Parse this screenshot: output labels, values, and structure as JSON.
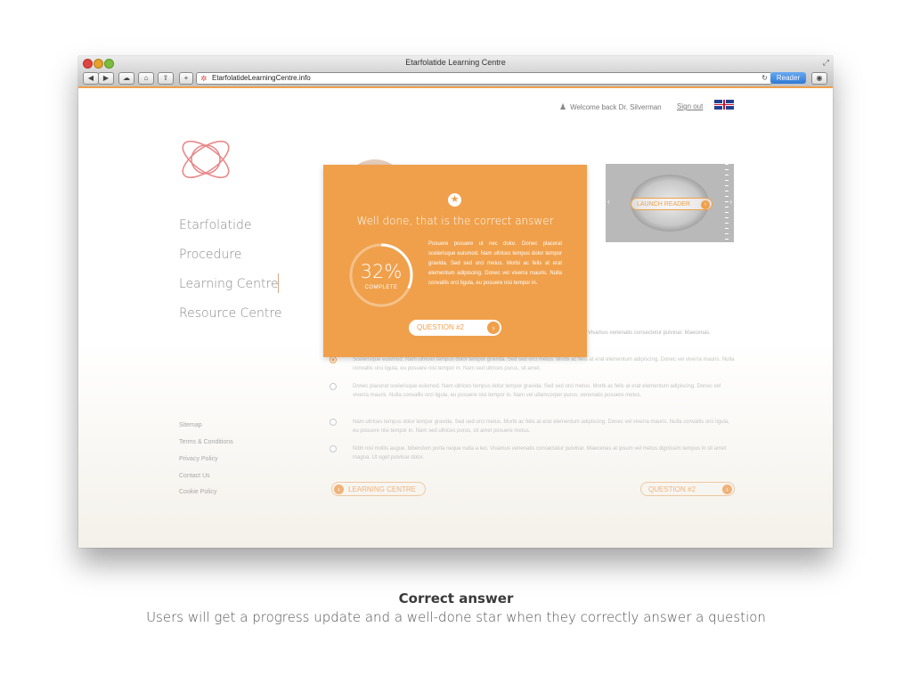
{
  "window": {
    "title": "Etarfolatide Learning Centre",
    "url": "EtarfolatideLearningCentre.info",
    "reader_label": "Reader",
    "reload_glyph": "↻",
    "fullscreen_glyph": "⤢",
    "toolbar": {
      "back": "◀",
      "forward": "▶",
      "cloud": "☁",
      "home": "⌂",
      "share": "⇪",
      "add": "+",
      "downloads": "◉"
    }
  },
  "header": {
    "welcome": "Welcome back Dr. Silverman",
    "sign_out": "Sign out",
    "language_flag": "uk-flag-icon"
  },
  "sidebar": {
    "items": [
      {
        "label": "Etarfolatide"
      },
      {
        "label": "Procedure"
      },
      {
        "label": "Learning Centre",
        "active": true
      },
      {
        "label": "Resource Centre"
      }
    ],
    "footer_links": [
      "Sitemap",
      "Terms & Conditions",
      "Privacy Policy",
      "Contact Us",
      "Cookie Policy"
    ]
  },
  "hero": {
    "launch_label": "LAUNCH READER",
    "arrow": "›",
    "prev": "‹",
    "next": "›"
  },
  "question": {
    "intro": "Vivamus venenatis consectetur pulvinar. Maecenas.",
    "answers": [
      {
        "text": "Scelerisque euismod. Nam ultrices tempus dolor tempor gravida. Sed sed orci metus. Morbi ac felis at erat elementum adipiscing. Donec vel viverra mauris. Nulla convallis orci ligula, eu posuere nisi tempor in. Nam sed ultrices purus, sit amet.",
        "selected": true
      },
      {
        "text": "Donec placerat scelerisque euismod. Nam ultrices tempus dolor tempor gravida. Sed sed orci metus. Morbi ac felis at erat elementum adipiscing. Donec vel viverra mauris. Nulla convallis orci ligula, eu posuere nisi tempor in. Nam vel ullamcorper purus, venenatis posuere metus.",
        "selected": false
      },
      {
        "text": "Nam ultrices tempus dolor tempor gravida. Sed sed orci metus. Morbi ac felis at erat elementum adipiscing. Donec vel viverra mauris. Nulla convallis orci ligula, eu posuere nisi tempor in. Nam sed ultrices purus, sit amet posuere metus.",
        "selected": false
      },
      {
        "text": "Nibh nisl mollis augue, bibendum porta neque nulla a leo. Vivamus venenatis consectetur pulvinar. Maecenas at ipsum vel metus dignissim tempus in sit amet magna. Ut eget pulvinar dolor.",
        "selected": false
      }
    ],
    "prev_label": "LEARNING CENTRE",
    "next_label": "QUESTION #2",
    "prev_glyph": "‹",
    "next_glyph": "›"
  },
  "overlay": {
    "title": "Well done, that is the correct answer",
    "star": "★",
    "progress": 0.32,
    "percent_text": "32%",
    "percent_label": "COMPLETE",
    "body": "Posuere posuere ut nec dolor. Donec placerat scelerisque euismod. Nam ultrices tempus dolor tempor gravida. Sed sed orci metus. Morbi ac felis at erat elementum adipiscing. Donec vel viverra mauris. Nulla convallis orci ligula, eu posuere nisi tempor in.",
    "button_label": "QUESTION #2",
    "button_glyph": "›"
  },
  "caption": {
    "title": "Correct answer",
    "subtitle": "Users will get a progress update and a well-done star when they correctly answer a question"
  },
  "colors": {
    "accent": "#f0a04b",
    "logo": "#e8888a"
  }
}
